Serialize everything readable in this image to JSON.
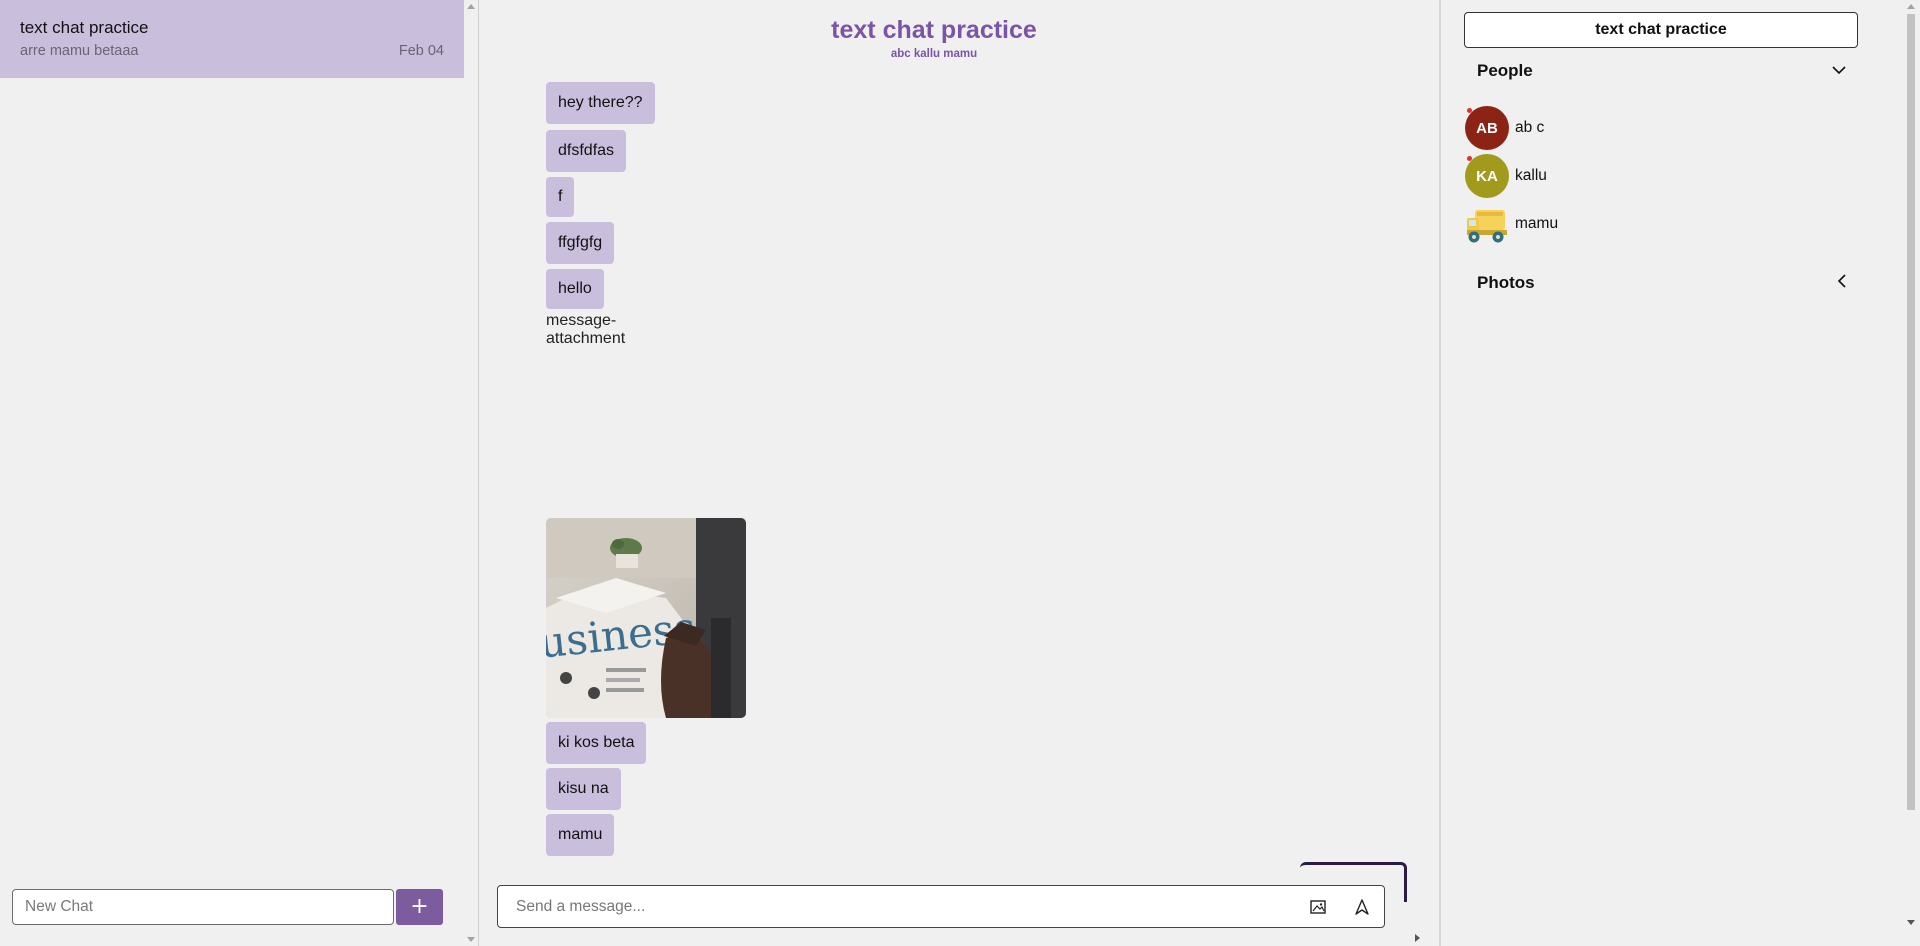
{
  "sidebar": {
    "chats": [
      {
        "title": "text chat practice",
        "preview": "arre mamu betaaa",
        "date": "Feb 04"
      }
    ],
    "new_chat_placeholder": "New Chat",
    "new_chat_button": "+"
  },
  "chat": {
    "title": "text chat practice",
    "members_line": "abc kallu mamu",
    "messages": [
      "hey there??",
      "dfsfdfas",
      "f",
      "ffgfgfg",
      "hello",
      "ki kos beta",
      "kisu na",
      "mamu"
    ],
    "broken_attachment_alt": "message-attachment",
    "photo_alt": "message-attachment",
    "composer_placeholder": "Send a message..."
  },
  "details": {
    "title": "text chat practice",
    "people_label": "People",
    "photos_label": "Photos",
    "people": [
      {
        "initials": "AB",
        "name": "ab c",
        "color": "#8c2415"
      },
      {
        "initials": "KA",
        "name": "kallu",
        "color": "#a19a1d"
      },
      {
        "initials": "",
        "name": "mamu",
        "color": "#f5d35a"
      }
    ]
  },
  "colors": {
    "accent": "#7a55a6",
    "bubble": "#cabedd",
    "button": "#7c5c9e"
  }
}
